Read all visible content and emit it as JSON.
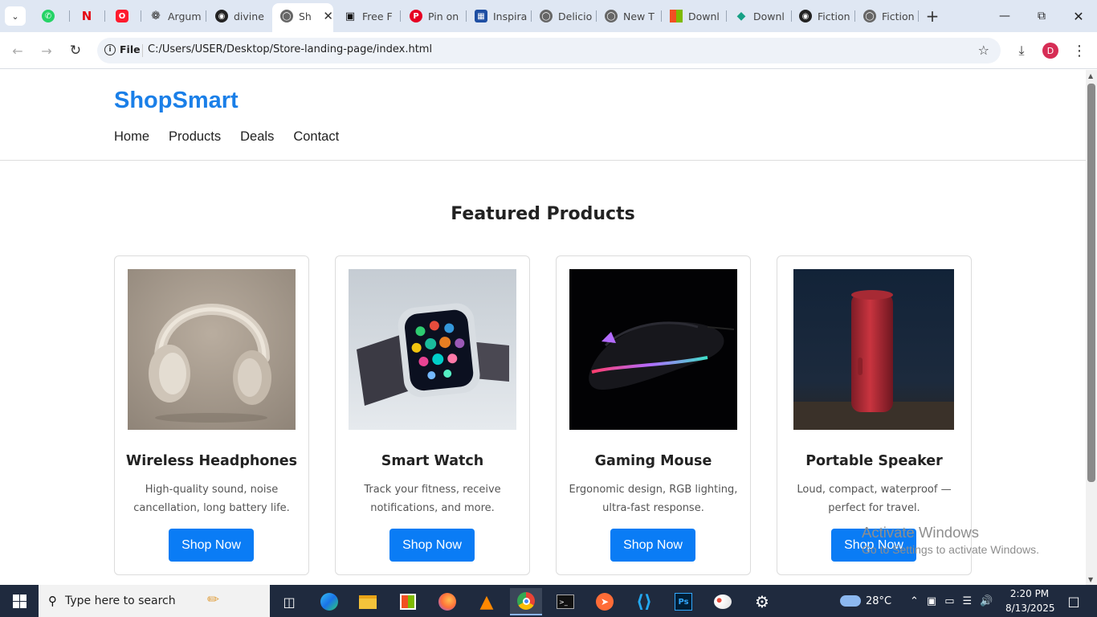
{
  "browser": {
    "tabs": [
      {
        "label": "",
        "icon": "whatsapp-icon",
        "color": "#25d366"
      },
      {
        "label": "",
        "icon": "netflix-icon",
        "color": "#e50914"
      },
      {
        "label": "",
        "icon": "opera-icon",
        "color": "#ff1b2d"
      },
      {
        "label": "Argum",
        "icon": "openai-icon",
        "color": "#333333"
      },
      {
        "label": "divine",
        "icon": "github-icon",
        "color": "#222222"
      },
      {
        "label": "Sh",
        "icon": "globe-icon",
        "color": "#555555",
        "active": true
      },
      {
        "label": "Free F",
        "icon": "unsplash-icon",
        "color": "#111111"
      },
      {
        "label": "Pin on",
        "icon": "pinterest-icon",
        "color": "#e60023"
      },
      {
        "label": "Inspira",
        "icon": "inspiration-icon",
        "color": "#1f4fa3"
      },
      {
        "label": "Delicio",
        "icon": "globe-icon",
        "color": "#555555"
      },
      {
        "label": "New T",
        "icon": "globe-icon",
        "color": "#555555"
      },
      {
        "label": "Downl",
        "icon": "microsoft-icon",
        "color": "#f25022"
      },
      {
        "label": "Downl",
        "icon": "diamond-icon",
        "color": "#16a085"
      },
      {
        "label": "Fiction",
        "icon": "github-icon",
        "color": "#222222"
      },
      {
        "label": "Fiction",
        "icon": "globe-icon",
        "color": "#555555"
      }
    ],
    "address": {
      "scheme_label": "File",
      "url": "C:/Users/USER/Desktop/Store-landing-page/index.html"
    },
    "profile_initial": "D"
  },
  "site": {
    "logo": "ShopSmart",
    "nav": [
      "Home",
      "Products",
      "Deals",
      "Contact"
    ],
    "section_title": "Featured Products",
    "products": [
      {
        "title": "Wireless Headphones",
        "desc": "High-quality sound, noise cancellation, long battery life.",
        "button": "Shop Now"
      },
      {
        "title": "Smart Watch",
        "desc": "Track your fitness, receive notifications, and more.",
        "button": "Shop Now"
      },
      {
        "title": "Gaming Mouse",
        "desc": "Ergonomic design, RGB lighting, ultra-fast response.",
        "button": "Shop Now"
      },
      {
        "title": "Portable Speaker",
        "desc": "Loud, compact, waterproof — perfect for travel.",
        "button": "Shop Now"
      }
    ],
    "brand_color": "#1a7fe8",
    "button_color": "#0a7cf5"
  },
  "watermark": {
    "line1": "Activate Windows",
    "line2": "Go to Settings to activate Windows."
  },
  "taskbar": {
    "search_placeholder": "Type here to search",
    "weather": "28°C",
    "time": "2:20 PM",
    "date": "8/13/2025"
  }
}
